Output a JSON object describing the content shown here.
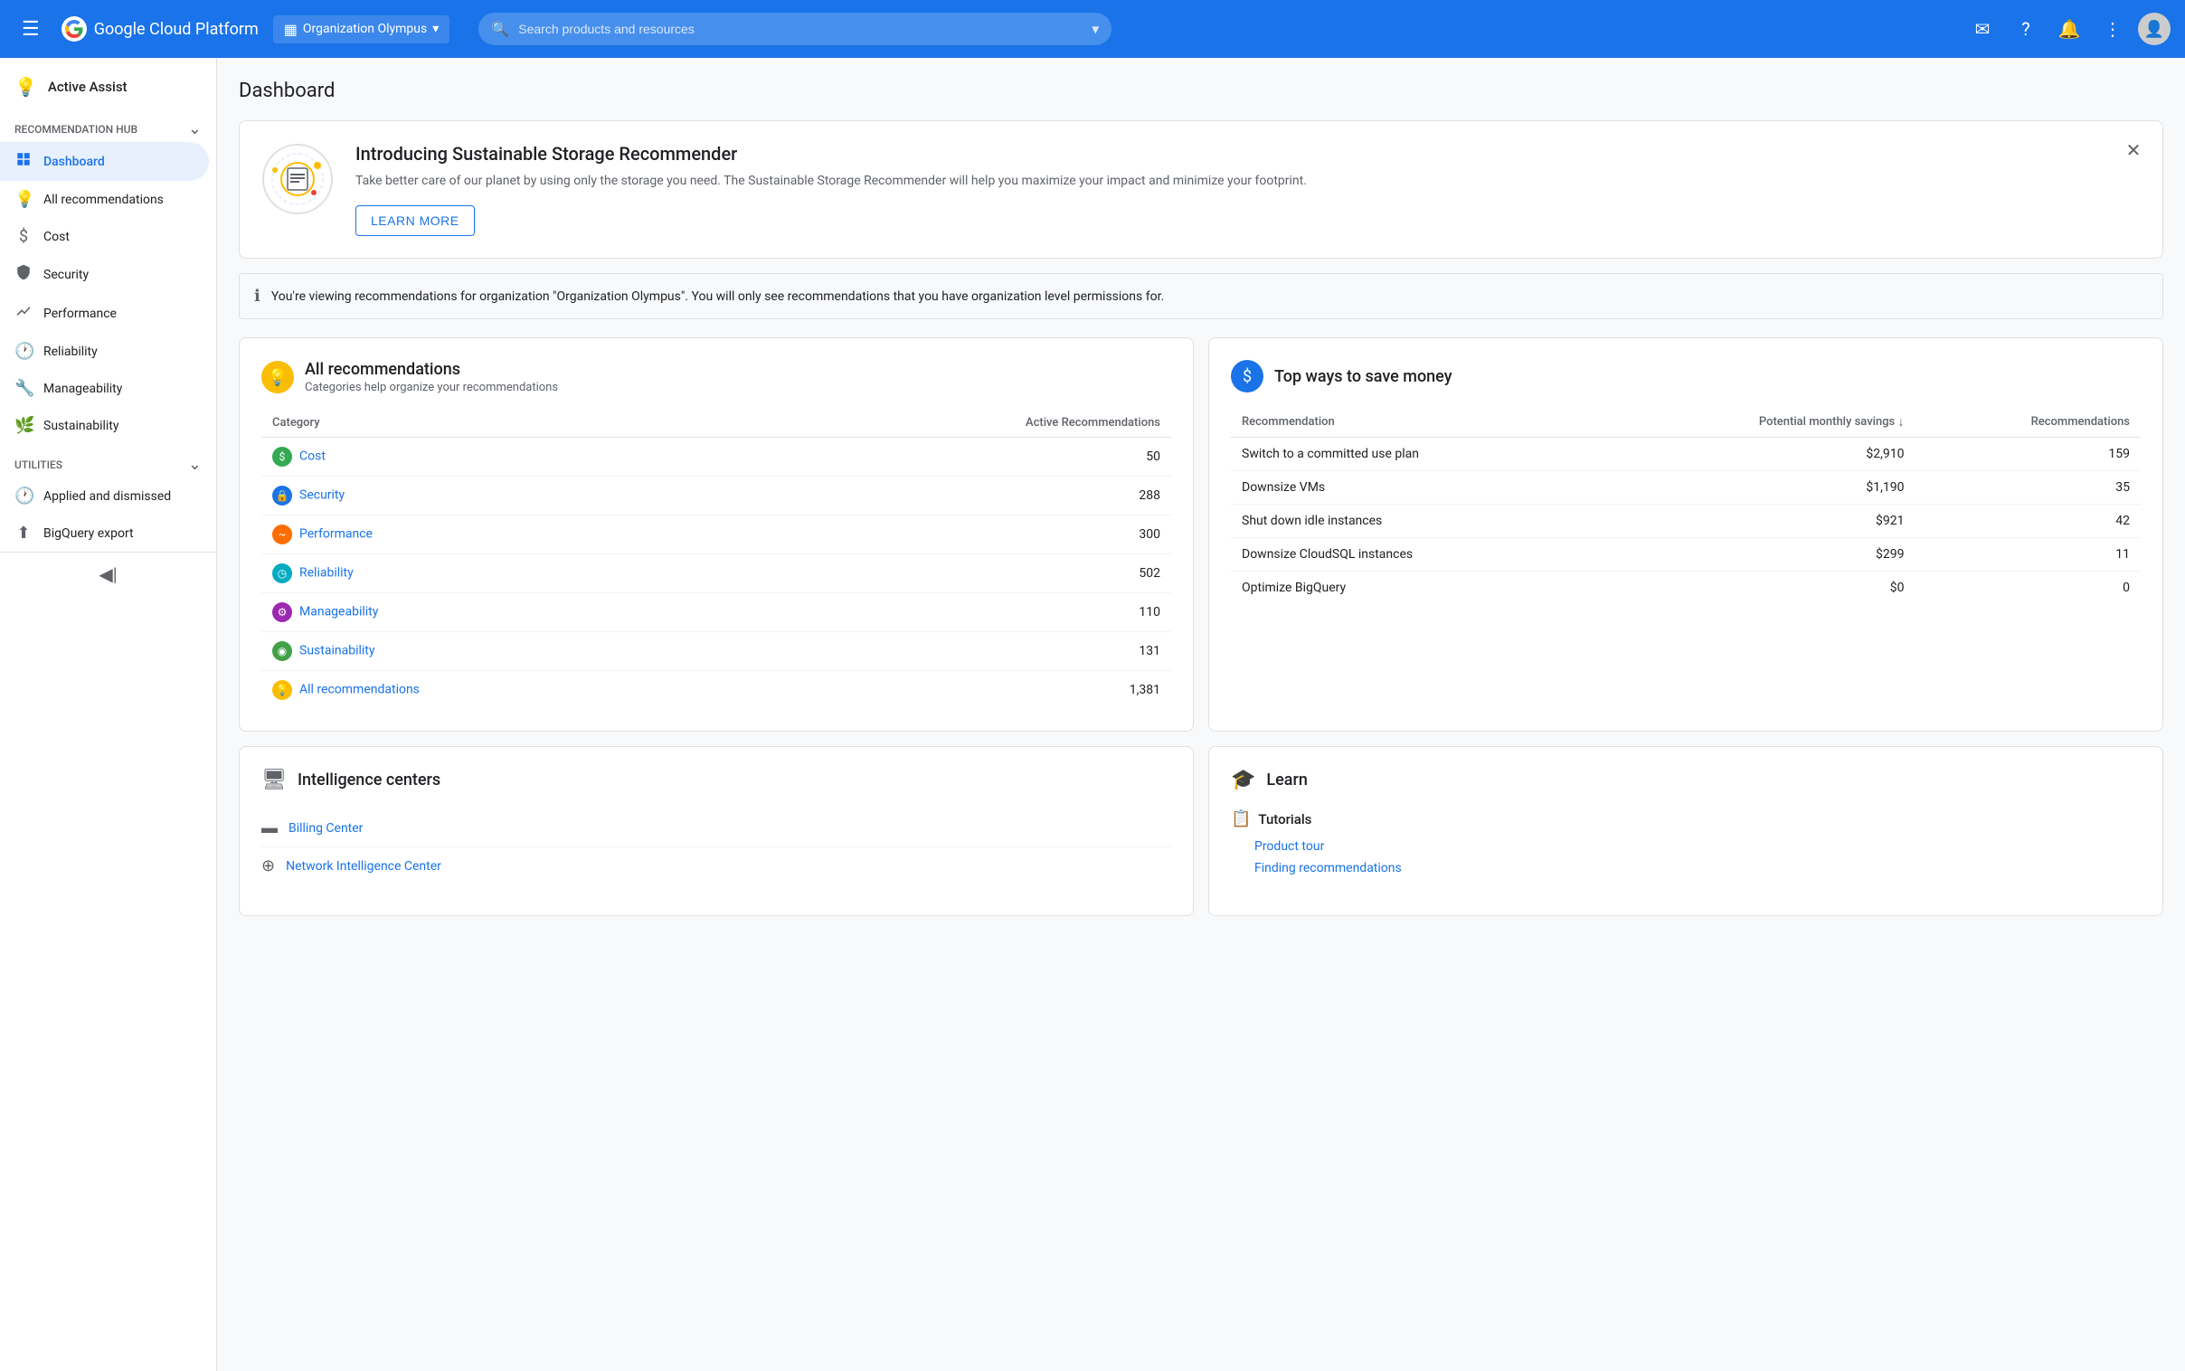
{
  "nav": {
    "hamburger_label": "☰",
    "logo": "Google Cloud Platform",
    "org_label": "Organization Olympus",
    "org_icon": "▦",
    "search_placeholder": "Search products and resources",
    "actions": [
      "✉",
      "?",
      "🔔",
      "⋮"
    ]
  },
  "sidebar": {
    "active_assist_label": "Active Assist",
    "recommendation_hub_label": "Recommendation Hub",
    "items": [
      {
        "id": "dashboard",
        "label": "Dashboard",
        "icon": "▦",
        "active": true
      },
      {
        "id": "all-recommendations",
        "label": "All recommendations",
        "icon": "💡"
      },
      {
        "id": "cost",
        "label": "Cost",
        "icon": "$"
      },
      {
        "id": "security",
        "label": "Security",
        "icon": "🔒"
      },
      {
        "id": "performance",
        "label": "Performance",
        "icon": "📈"
      },
      {
        "id": "reliability",
        "label": "Reliability",
        "icon": "🕐"
      },
      {
        "id": "manageability",
        "label": "Manageability",
        "icon": "🔧"
      },
      {
        "id": "sustainability",
        "label": "Sustainability",
        "icon": "🌿"
      }
    ],
    "utilities_label": "Utilities",
    "utility_items": [
      {
        "id": "applied-dismissed",
        "label": "Applied and dismissed",
        "icon": "🕐"
      },
      {
        "id": "bigquery-export",
        "label": "BigQuery export",
        "icon": "⬆"
      }
    ],
    "collapse_label": "◀"
  },
  "page": {
    "title": "Dashboard"
  },
  "banner": {
    "title": "Introducing Sustainable Storage Recommender",
    "description": "Take better care of our planet by using only the storage you need. The Sustainable Storage Recommender will help you maximize your impact and minimize your footprint.",
    "learn_more_label": "LEARN MORE",
    "close_label": "✕"
  },
  "info_bar": {
    "text": "You're viewing recommendations for organization \"Organization Olympus\". You will only see recommendations that you have organization level permissions for."
  },
  "all_recommendations": {
    "title": "All recommendations",
    "subtitle": "Categories help organize your recommendations",
    "col_category": "Category",
    "col_active": "Active Recommendations",
    "rows": [
      {
        "icon": "green",
        "label": "Cost",
        "count": "50"
      },
      {
        "icon": "blue",
        "label": "Security",
        "count": "288"
      },
      {
        "icon": "orange",
        "label": "Performance",
        "count": "300"
      },
      {
        "icon": "teal",
        "label": "Reliability",
        "count": "502"
      },
      {
        "icon": "purple",
        "label": "Manageability",
        "count": "110"
      },
      {
        "icon": "leaf",
        "label": "Sustainability",
        "count": "131"
      },
      {
        "icon": "yellow",
        "label": "All recommendations",
        "count": "1,381"
      }
    ]
  },
  "top_savings": {
    "title": "Top ways to save money",
    "col_recommendation": "Recommendation",
    "col_savings": "Potential monthly savings",
    "col_count": "Recommendations",
    "rows": [
      {
        "label": "Switch to a committed use plan",
        "savings": "$2,910",
        "count": "159"
      },
      {
        "label": "Downsize VMs",
        "savings": "$1,190",
        "count": "35"
      },
      {
        "label": "Shut down idle instances",
        "savings": "$921",
        "count": "42"
      },
      {
        "label": "Downsize CloudSQL instances",
        "savings": "$299",
        "count": "11"
      },
      {
        "label": "Optimize BigQuery",
        "savings": "$0",
        "count": "0"
      }
    ]
  },
  "intelligence_centers": {
    "title": "Intelligence centers",
    "items": [
      {
        "label": "Billing Center",
        "icon": "▬"
      },
      {
        "label": "Network Intelligence Center",
        "icon": "⊕"
      }
    ]
  },
  "learn": {
    "title": "Learn",
    "sections": [
      {
        "title": "Tutorials",
        "icon": "📋",
        "links": [
          "Product tour",
          "Finding recommendations"
        ]
      }
    ]
  }
}
